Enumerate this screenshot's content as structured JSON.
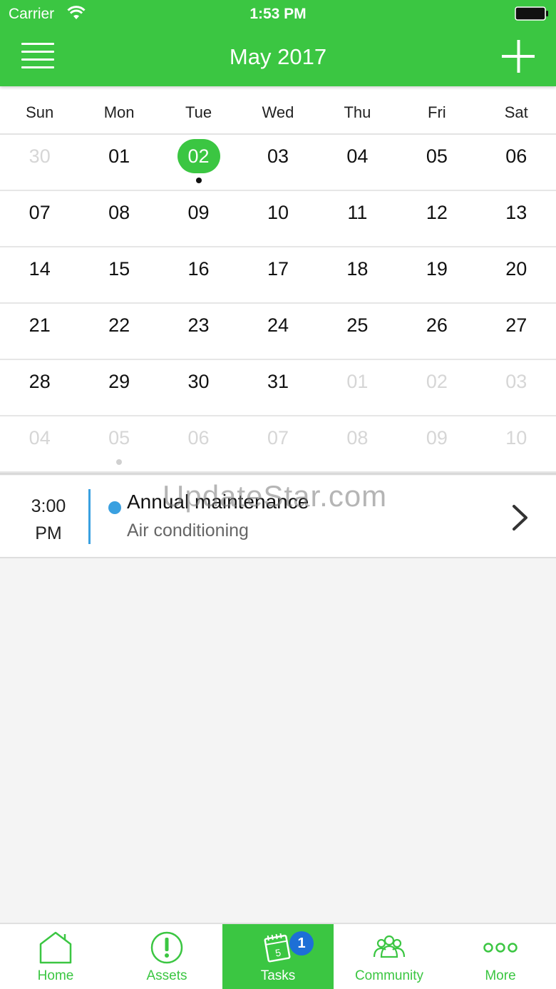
{
  "status_bar": {
    "carrier": "Carrier",
    "time": "1:53 PM"
  },
  "header": {
    "title": "May 2017",
    "menu_icon": "hamburger-icon",
    "add_icon": "plus-icon"
  },
  "calendar": {
    "weekdays": [
      "Sun",
      "Mon",
      "Tue",
      "Wed",
      "Thu",
      "Fri",
      "Sat"
    ],
    "weeks": [
      [
        {
          "d": "30",
          "other": true
        },
        {
          "d": "01"
        },
        {
          "d": "02",
          "selected": true,
          "dot": true
        },
        {
          "d": "03"
        },
        {
          "d": "04"
        },
        {
          "d": "05"
        },
        {
          "d": "06"
        }
      ],
      [
        {
          "d": "07"
        },
        {
          "d": "08"
        },
        {
          "d": "09"
        },
        {
          "d": "10"
        },
        {
          "d": "11"
        },
        {
          "d": "12"
        },
        {
          "d": "13"
        }
      ],
      [
        {
          "d": "14"
        },
        {
          "d": "15"
        },
        {
          "d": "16"
        },
        {
          "d": "17"
        },
        {
          "d": "18"
        },
        {
          "d": "19"
        },
        {
          "d": "20"
        }
      ],
      [
        {
          "d": "21"
        },
        {
          "d": "22"
        },
        {
          "d": "23"
        },
        {
          "d": "24"
        },
        {
          "d": "25"
        },
        {
          "d": "26"
        },
        {
          "d": "27"
        }
      ],
      [
        {
          "d": "28"
        },
        {
          "d": "29"
        },
        {
          "d": "30"
        },
        {
          "d": "31"
        },
        {
          "d": "01",
          "other": true
        },
        {
          "d": "02",
          "other": true
        },
        {
          "d": "03",
          "other": true
        }
      ],
      [
        {
          "d": "04",
          "other": true
        },
        {
          "d": "05",
          "other": true,
          "dot": true
        },
        {
          "d": "06",
          "other": true
        },
        {
          "d": "07",
          "other": true
        },
        {
          "d": "08",
          "other": true
        },
        {
          "d": "09",
          "other": true
        },
        {
          "d": "10",
          "other": true
        }
      ]
    ]
  },
  "event": {
    "time_line1": "3:00",
    "time_line2": "PM",
    "title": "Annual maintenance",
    "subtitle": "Air conditioning",
    "accent_color": "#3aa0e0"
  },
  "watermark": "UpdateStar.com",
  "tabs": [
    {
      "label": "Home",
      "icon": "home-icon",
      "active": false
    },
    {
      "label": "Assets",
      "icon": "alert-circle-icon",
      "active": false
    },
    {
      "label": "Tasks",
      "icon": "calendar-pad-icon",
      "active": true,
      "badge": "1"
    },
    {
      "label": "Community",
      "icon": "people-icon",
      "active": false
    },
    {
      "label": "More",
      "icon": "more-dots-icon",
      "active": false
    }
  ],
  "colors": {
    "brand": "#3bc642",
    "badge": "#1d6fd6"
  }
}
